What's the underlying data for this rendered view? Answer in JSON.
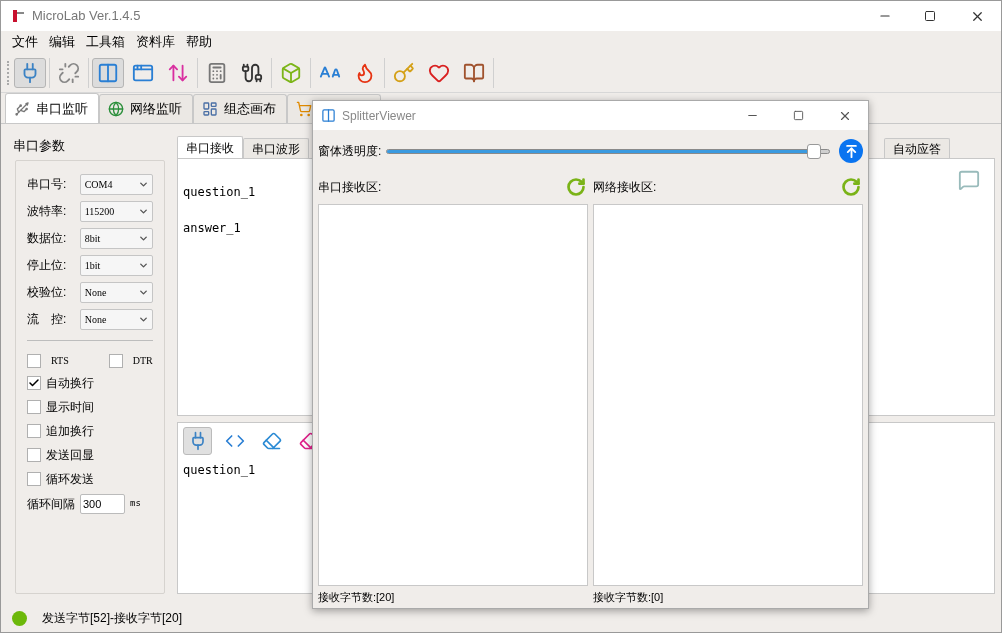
{
  "window": {
    "title": "MicroLab Ver.1.4.5"
  },
  "menu": [
    "文件",
    "编辑",
    "工具箱",
    "资料库",
    "帮助"
  ],
  "toolbar_groups": [
    [
      {
        "pressed": true
      }
    ],
    [
      {
        "pressed": false
      }
    ],
    [
      {
        "pressed": true
      },
      {
        "pressed": false
      },
      {
        "pressed": false
      }
    ],
    [
      {
        "pressed": false
      },
      {
        "pressed": false
      }
    ],
    [
      {
        "pressed": false
      }
    ],
    [
      {
        "pressed": false
      },
      {
        "pressed": false
      }
    ],
    [
      {
        "pressed": false
      },
      {
        "pressed": false
      },
      {
        "pressed": false
      }
    ]
  ],
  "main_tabs": [
    {
      "label": "串口监听",
      "selected": true
    },
    {
      "label": "网络监听",
      "selected": false
    },
    {
      "label": "组态画布",
      "selected": false
    },
    {
      "selected": false
    }
  ],
  "serial_params": {
    "title": "串口参数",
    "fields": [
      {
        "label": "串口号:",
        "value": "COM4"
      },
      {
        "label": "波特率:",
        "value": "115200"
      },
      {
        "label": "数据位:",
        "value": "8bit"
      },
      {
        "label": "停止位:",
        "value": "1bit"
      },
      {
        "label": "校验位:",
        "value": "None"
      },
      {
        "label": "流　控:",
        "value": "None"
      }
    ],
    "lines": [
      {
        "label": "RTS",
        "checked": false
      },
      {
        "label": "DTR",
        "checked": false
      }
    ],
    "options": [
      {
        "label": "自动换行",
        "checked": true
      },
      {
        "label": "显示时间",
        "checked": false
      },
      {
        "label": "追加换行",
        "checked": false
      },
      {
        "label": "发送回显",
        "checked": false
      },
      {
        "label": "循环发送",
        "checked": false
      }
    ],
    "interval": {
      "label": "循环间隔",
      "value": "300",
      "unit": "ms"
    }
  },
  "receive_tabs": [
    {
      "label": "串口接收",
      "selected": true
    },
    {
      "label": "串口波形",
      "selected": false
    },
    {
      "label": "自动应答",
      "selected": false
    }
  ],
  "receive_lines": [
    "question_1",
    "answer_1"
  ],
  "send_toolbar": [
    {
      "pressed": true
    },
    {
      "pressed": false
    },
    {
      "pressed": false
    },
    {
      "pressed": false
    }
  ],
  "send_text": "question_1",
  "status": {
    "text": "发送字节[52]-接收字节[20]",
    "connected": true
  },
  "viewer": {
    "title": "SplitterViewer",
    "opacity": {
      "label": "窗体透明度:",
      "level": 0.97
    },
    "panes": [
      {
        "label": "串口接收区:",
        "count": "接收字节数:[20]"
      },
      {
        "label": "网络接收区:",
        "count": "接收字节数:[0]"
      }
    ]
  }
}
